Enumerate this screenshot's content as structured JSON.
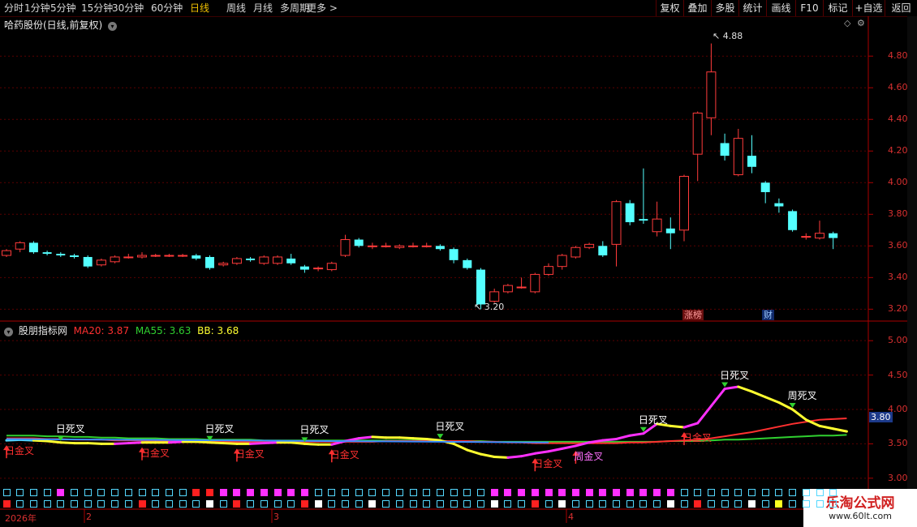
{
  "topbar": {
    "periods": [
      "分时",
      "1分钟",
      "5分钟",
      "15分钟",
      "30分钟",
      "60分钟",
      "日线",
      "周线",
      "月线",
      "多周期",
      "更多 >"
    ],
    "active": "日线",
    "buttons": [
      "复权",
      "叠加",
      "多股",
      "统计",
      "画线",
      "F10",
      "标记",
      "+自选",
      "返回"
    ]
  },
  "main_title": "哈药股份(日线,前复权)",
  "main_axis": [
    "4.80",
    "4.60",
    "4.40",
    "4.20",
    "4.00",
    "3.80",
    "3.60",
    "3.40",
    "3.20"
  ],
  "high_label": "4.88",
  "low_label": "3.20",
  "main_tags": [
    "涨榜",
    "财"
  ],
  "indicator": {
    "name": "股朋指标网",
    "ma20": "MA20: 3.87",
    "ma55": "MA55: 3.63",
    "bb": "BB: 3.68",
    "axis": [
      "5.00",
      "4.50",
      "4.00",
      "3.50",
      "3.00"
    ],
    "current": "3.80",
    "death_label": "日死叉",
    "golden_label": "日金叉",
    "week_death": "周死叉",
    "week_golden": "周金叉"
  },
  "date_labels": [
    "2026年",
    "2",
    "3",
    "4"
  ],
  "watermark": {
    "title": "乐淘公式网",
    "url": "www.60lt.com"
  },
  "colors": {
    "up": "#ff3b3b",
    "down": "#54ffff",
    "ma20": "#ff3030",
    "ma55": "#30d030",
    "bb": "#ffff30",
    "magenta": "#ff30ff"
  },
  "chart_data": {
    "type": "candlestick",
    "candles": [
      {
        "o": 3.54,
        "c": 3.57,
        "h": 3.58,
        "l": 3.53
      },
      {
        "o": 3.58,
        "c": 3.62,
        "h": 3.63,
        "l": 3.56
      },
      {
        "o": 3.62,
        "c": 3.56,
        "h": 3.63,
        "l": 3.55
      },
      {
        "o": 3.56,
        "c": 3.55,
        "h": 3.57,
        "l": 3.54
      },
      {
        "o": 3.55,
        "c": 3.54,
        "h": 3.56,
        "l": 3.53
      },
      {
        "o": 3.54,
        "c": 3.53,
        "h": 3.55,
        "l": 3.52
      },
      {
        "o": 3.53,
        "c": 3.47,
        "h": 3.54,
        "l": 3.46
      },
      {
        "o": 3.48,
        "c": 3.51,
        "h": 3.52,
        "l": 3.47
      },
      {
        "o": 3.5,
        "c": 3.53,
        "h": 3.54,
        "l": 3.49
      },
      {
        "o": 3.53,
        "c": 3.53,
        "h": 3.55,
        "l": 3.52
      },
      {
        "o": 3.53,
        "c": 3.54,
        "h": 3.56,
        "l": 3.52
      },
      {
        "o": 3.54,
        "c": 3.54,
        "h": 3.55,
        "l": 3.53
      },
      {
        "o": 3.54,
        "c": 3.54,
        "h": 3.55,
        "l": 3.53
      },
      {
        "o": 3.54,
        "c": 3.54,
        "h": 3.55,
        "l": 3.53
      },
      {
        "o": 3.54,
        "c": 3.52,
        "h": 3.55,
        "l": 3.51
      },
      {
        "o": 3.53,
        "c": 3.46,
        "h": 3.54,
        "l": 3.45
      },
      {
        "o": 3.48,
        "c": 3.49,
        "h": 3.5,
        "l": 3.47
      },
      {
        "o": 3.49,
        "c": 3.52,
        "h": 3.53,
        "l": 3.48
      },
      {
        "o": 3.52,
        "c": 3.51,
        "h": 3.53,
        "l": 3.5
      },
      {
        "o": 3.49,
        "c": 3.53,
        "h": 3.54,
        "l": 3.48
      },
      {
        "o": 3.49,
        "c": 3.53,
        "h": 3.54,
        "l": 3.48
      },
      {
        "o": 3.52,
        "c": 3.49,
        "h": 3.55,
        "l": 3.48
      },
      {
        "o": 3.47,
        "c": 3.45,
        "h": 3.48,
        "l": 3.43
      },
      {
        "o": 3.46,
        "c": 3.46,
        "h": 3.47,
        "l": 3.44
      },
      {
        "o": 3.45,
        "c": 3.49,
        "h": 3.5,
        "l": 3.44
      },
      {
        "o": 3.54,
        "c": 3.64,
        "h": 3.67,
        "l": 3.53
      },
      {
        "o": 3.64,
        "c": 3.6,
        "h": 3.65,
        "l": 3.59
      },
      {
        "o": 3.6,
        "c": 3.6,
        "h": 3.62,
        "l": 3.58
      },
      {
        "o": 3.6,
        "c": 3.6,
        "h": 3.62,
        "l": 3.59
      },
      {
        "o": 3.59,
        "c": 3.6,
        "h": 3.61,
        "l": 3.58
      },
      {
        "o": 3.6,
        "c": 3.6,
        "h": 3.62,
        "l": 3.59
      },
      {
        "o": 3.6,
        "c": 3.6,
        "h": 3.62,
        "l": 3.59
      },
      {
        "o": 3.6,
        "c": 3.58,
        "h": 3.61,
        "l": 3.57
      },
      {
        "o": 3.58,
        "c": 3.51,
        "h": 3.59,
        "l": 3.49
      },
      {
        "o": 3.51,
        "c": 3.46,
        "h": 3.52,
        "l": 3.45
      },
      {
        "o": 3.45,
        "c": 3.23,
        "h": 3.46,
        "l": 3.2
      },
      {
        "o": 3.25,
        "c": 3.31,
        "h": 3.33,
        "l": 3.24
      },
      {
        "o": 3.31,
        "c": 3.35,
        "h": 3.36,
        "l": 3.3
      },
      {
        "o": 3.34,
        "c": 3.34,
        "h": 3.4,
        "l": 3.33
      },
      {
        "o": 3.31,
        "c": 3.42,
        "h": 3.43,
        "l": 3.3
      },
      {
        "o": 3.42,
        "c": 3.47,
        "h": 3.49,
        "l": 3.41
      },
      {
        "o": 3.47,
        "c": 3.54,
        "h": 3.55,
        "l": 3.45
      },
      {
        "o": 3.53,
        "c": 3.59,
        "h": 3.6,
        "l": 3.52
      },
      {
        "o": 3.59,
        "c": 3.61,
        "h": 3.62,
        "l": 3.58
      },
      {
        "o": 3.6,
        "c": 3.54,
        "h": 3.63,
        "l": 3.53
      },
      {
        "o": 3.61,
        "c": 3.88,
        "h": 3.89,
        "l": 3.47
      },
      {
        "o": 3.87,
        "c": 3.75,
        "h": 3.89,
        "l": 3.73
      },
      {
        "o": 3.77,
        "c": 3.76,
        "h": 4.09,
        "l": 3.74
      },
      {
        "o": 3.69,
        "c": 3.77,
        "h": 3.88,
        "l": 3.66
      },
      {
        "o": 3.71,
        "c": 3.68,
        "h": 3.78,
        "l": 3.58
      },
      {
        "o": 3.7,
        "c": 4.04,
        "h": 4.05,
        "l": 3.63
      },
      {
        "o": 4.18,
        "c": 4.44,
        "h": 4.45,
        "l": 4.01
      },
      {
        "o": 4.41,
        "c": 4.7,
        "h": 4.88,
        "l": 4.3
      },
      {
        "o": 4.25,
        "c": 4.17,
        "h": 4.31,
        "l": 4.14
      },
      {
        "o": 4.05,
        "c": 4.28,
        "h": 4.34,
        "l": 4.04
      },
      {
        "o": 4.17,
        "c": 4.1,
        "h": 4.3,
        "l": 4.06
      },
      {
        "o": 4.0,
        "c": 3.94,
        "h": 4.01,
        "l": 3.87
      },
      {
        "o": 3.87,
        "c": 3.85,
        "h": 3.9,
        "l": 3.81
      },
      {
        "o": 3.82,
        "c": 3.7,
        "h": 3.83,
        "l": 3.69
      },
      {
        "o": 3.66,
        "c": 3.66,
        "h": 3.68,
        "l": 3.64
      },
      {
        "o": 3.65,
        "c": 3.68,
        "h": 3.76,
        "l": 3.64
      },
      {
        "o": 3.68,
        "c": 3.65,
        "h": 3.69,
        "l": 3.58
      }
    ],
    "ylim": [
      3.13,
      4.96
    ],
    "bb": [
      3.55,
      3.56,
      3.55,
      3.54,
      3.52,
      3.51,
      3.51,
      3.5,
      3.5,
      3.51,
      3.52,
      3.52,
      3.52,
      3.53,
      3.53,
      3.52,
      3.51,
      3.5,
      3.5,
      3.51,
      3.52,
      3.52,
      3.5,
      3.49,
      3.49,
      3.54,
      3.58,
      3.6,
      3.59,
      3.59,
      3.58,
      3.57,
      3.55,
      3.5,
      3.41,
      3.35,
      3.31,
      3.3,
      3.32,
      3.36,
      3.39,
      3.43,
      3.47,
      3.52,
      3.55,
      3.57,
      3.62,
      3.65,
      3.79,
      3.76,
      3.74,
      3.8,
      4.05,
      4.3,
      4.33,
      4.26,
      4.18,
      4.1,
      4.0,
      3.85,
      3.76,
      3.72,
      3.68
    ],
    "ma20": [
      3.58,
      3.58,
      3.58,
      3.57,
      3.57,
      3.56,
      3.56,
      3.56,
      3.55,
      3.55,
      3.55,
      3.54,
      3.54,
      3.54,
      3.54,
      3.54,
      3.53,
      3.53,
      3.53,
      3.53,
      3.53,
      3.53,
      3.53,
      3.53,
      3.53,
      3.53,
      3.53,
      3.53,
      3.54,
      3.54,
      3.54,
      3.54,
      3.54,
      3.54,
      3.54,
      3.53,
      3.53,
      3.52,
      3.52,
      3.51,
      3.51,
      3.51,
      3.51,
      3.51,
      3.51,
      3.51,
      3.52,
      3.52,
      3.53,
      3.54,
      3.55,
      3.56,
      3.58,
      3.61,
      3.64,
      3.67,
      3.71,
      3.75,
      3.79,
      3.82,
      3.85,
      3.86,
      3.87
    ],
    "ma55": [
      3.62,
      3.62,
      3.62,
      3.61,
      3.61,
      3.6,
      3.6,
      3.59,
      3.59,
      3.58,
      3.58,
      3.58,
      3.57,
      3.57,
      3.57,
      3.56,
      3.56,
      3.56,
      3.56,
      3.55,
      3.55,
      3.55,
      3.55,
      3.55,
      3.55,
      3.55,
      3.55,
      3.55,
      3.55,
      3.55,
      3.55,
      3.55,
      3.54,
      3.54,
      3.54,
      3.54,
      3.53,
      3.53,
      3.53,
      3.53,
      3.53,
      3.53,
      3.53,
      3.53,
      3.53,
      3.53,
      3.53,
      3.53,
      3.53,
      3.54,
      3.54,
      3.54,
      3.55,
      3.56,
      3.56,
      3.57,
      3.58,
      3.59,
      3.6,
      3.61,
      3.62,
      3.62,
      3.63
    ],
    "ind_ylim": [
      2.88,
      5.12
    ],
    "death_cross_idx": [
      4,
      15,
      22,
      32,
      47,
      53,
      58
    ],
    "golden_cross_idx": [
      0,
      10,
      17,
      24,
      39,
      42,
      50
    ],
    "squares_top": [
      "c",
      "c",
      "c",
      "c",
      "m",
      "c",
      "c",
      "c",
      "c",
      "c",
      "c",
      "c",
      "c",
      "c",
      "r",
      "r",
      "m",
      "m",
      "m",
      "m",
      "m",
      "m",
      "m",
      "c",
      "c",
      "c",
      "c",
      "c",
      "c",
      "c",
      "c",
      "c",
      "c",
      "c",
      "c",
      "c",
      "m",
      "m",
      "m",
      "m",
      "m",
      "m",
      "m",
      "m",
      "m",
      "m",
      "m",
      "m",
      "m",
      "m",
      "c",
      "c",
      "c",
      "c",
      "c",
      "c",
      "c",
      "c",
      "c",
      "c",
      "c",
      "c"
    ],
    "squares_bottom": [
      "r",
      "c",
      "c",
      "c",
      "c",
      "c",
      "c",
      "c",
      "c",
      "c",
      "r",
      "c",
      "c",
      "c",
      "c",
      "w",
      "c",
      "r",
      "c",
      "c",
      "c",
      "c",
      "r",
      "w",
      "c",
      "c",
      "c",
      "w",
      "c",
      "c",
      "c",
      "c",
      "c",
      "c",
      "c",
      "c",
      "w",
      "c",
      "c",
      "r",
      "c",
      "w",
      "c",
      "c",
      "c",
      "c",
      "c",
      "c",
      "c",
      "w",
      "c",
      "r",
      "c",
      "c",
      "c",
      "w",
      "c",
      "y",
      "c",
      "c",
      "c",
      "c"
    ]
  }
}
